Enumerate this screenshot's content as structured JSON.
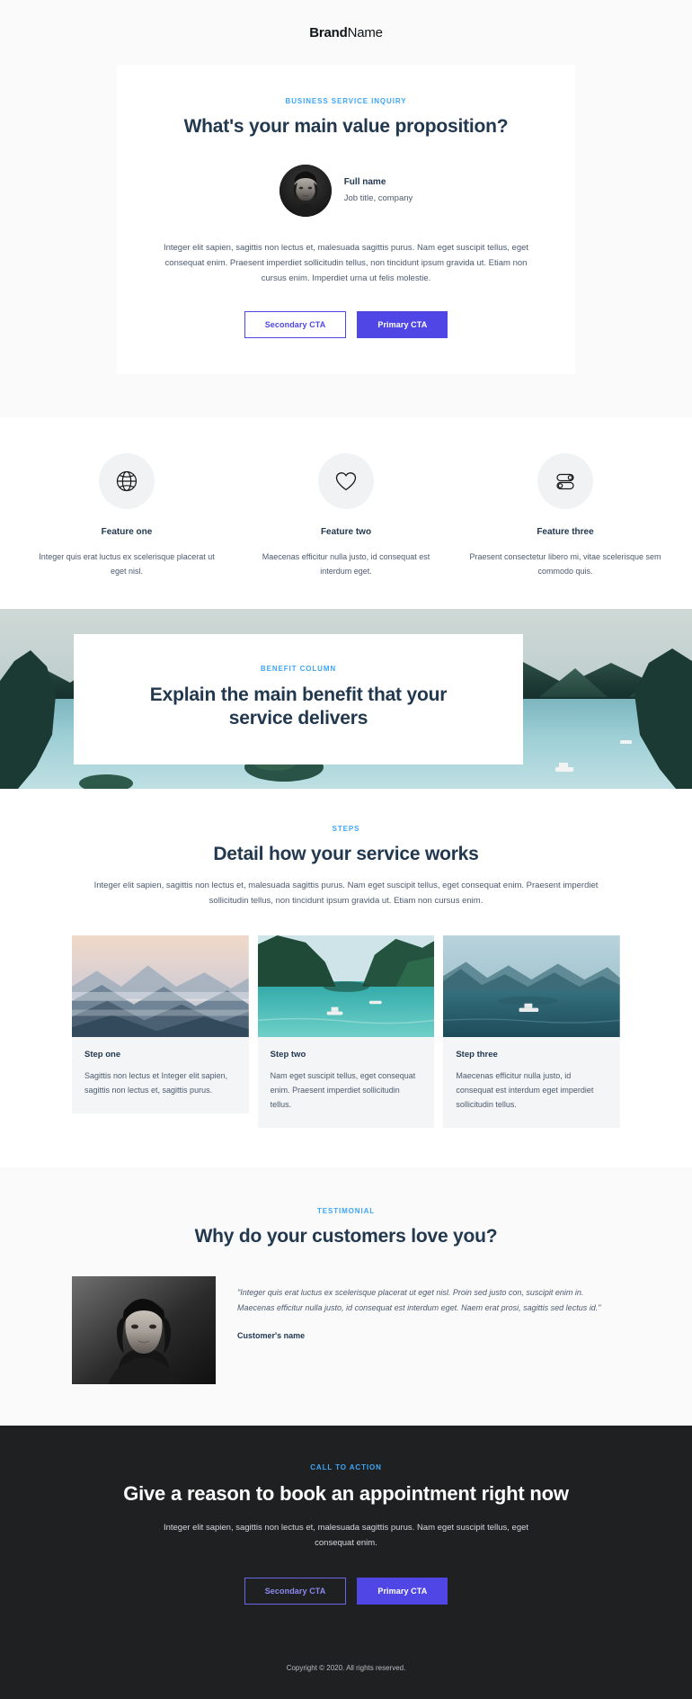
{
  "navbar": {
    "brand_bold": "Brand",
    "brand_light": "Name"
  },
  "hero": {
    "eyebrow": "BUSINESS SERVICE INQUIRY",
    "title": "What's your main value proposition?",
    "person_name": "Full name",
    "person_role": "Job title, company",
    "body": "Integer elit sapien, sagittis non lectus et, malesuada sagittis purus. Nam eget suscipit tellus, eget consequat enim. Praesent imperdiet sollicitudin tellus, non tincidunt ipsum gravida ut. Etiam non cursus enim. Imperdiet urna ut felis molestie.",
    "secondary_cta": "Secondary CTA",
    "primary_cta": "Primary CTA"
  },
  "features": [
    {
      "icon": "globe-icon",
      "title": "Feature one",
      "desc": "Integer quis erat luctus ex scelerisque placerat ut eget nisl."
    },
    {
      "icon": "heart-icon",
      "title": "Feature two",
      "desc": "Maecenas efficitur nulla justo, id consequat est interdum eget."
    },
    {
      "icon": "toggles-icon",
      "title": "Feature three",
      "desc": "Praesent consectetur libero mi, vitae scelerisque sem commodo quis."
    }
  ],
  "benefit": {
    "eyebrow": "BENEFIT COLUMN",
    "title": "Explain the main benefit that your service delivers"
  },
  "steps": {
    "eyebrow": "STEPS",
    "title": "Detail how your service works",
    "intro": "Integer elit sapien, sagittis non lectus et, malesuada sagittis purus. Nam eget suscipit tellus, eget consequat enim. Praesent imperdiet sollicitudin tellus, non tincidunt ipsum gravida ut. Etiam non cursus enim.",
    "cards": [
      {
        "title": "Step one",
        "desc": "Sagittis non lectus et Integer elit sapien, sagittis non lectus et, sagittis purus."
      },
      {
        "title": "Step two",
        "desc": "Nam eget suscipit tellus, eget consequat enim. Praesent imperdiet sollicitudin tellus."
      },
      {
        "title": "Step three",
        "desc": "Maecenas efficitur nulla justo, id consequat est interdum eget imperdiet sollicitudin tellus."
      }
    ]
  },
  "testimonial": {
    "eyebrow": "TESTIMONIAL",
    "title": "Why do your customers love you?",
    "quote": "\"Integer quis erat luctus ex scelerisque placerat ut eget nisl. Proin sed justo con, suscipit enim in. Maecenas efficitur nulla justo, id consequat est interdum eget. Naem erat prosi, sagittis sed lectus id.\"",
    "customer_name": "Customer's name"
  },
  "footer_cta": {
    "eyebrow": "CALL TO ACTION",
    "title": "Give a reason to book an appointment right now",
    "body": "Integer elit sapien, sagittis non lectus et, malesuada sagittis purus. Nam eget suscipit tellus, eget consequat enim.",
    "secondary_cta": "Secondary CTA",
    "primary_cta": "Primary CTA",
    "copyright": "Copyright © 2020. All rights reserved."
  },
  "colors": {
    "accent_blue": "#3da5f5",
    "primary_purple": "#4f46e5",
    "heading_navy": "#22384f",
    "dark_bg": "#1f2022"
  }
}
